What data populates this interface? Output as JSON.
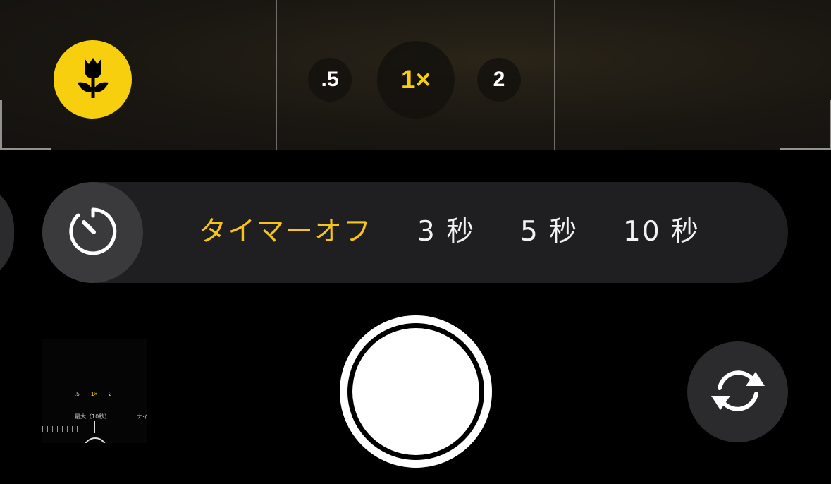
{
  "viewfinder": {
    "zoom_levels": [
      {
        "label": ".5",
        "active": false
      },
      {
        "label": "1×",
        "active": true
      },
      {
        "label": "2",
        "active": false
      }
    ],
    "macro_icon": "tulip-icon",
    "macro_color": "#f7cf0e"
  },
  "timer": {
    "icon": "timer-icon",
    "options": [
      {
        "label": "タイマーオフ",
        "selected": true
      },
      {
        "label": "3 秒",
        "selected": false
      },
      {
        "label": "5 秒",
        "selected": false
      },
      {
        "label": "10 秒",
        "selected": false
      }
    ],
    "selected_color": "#f7c51a"
  },
  "thumbnail": {
    "zoom_labels": [
      ".5",
      "1×",
      "2"
    ],
    "caption": "最大（10秒）",
    "caption_right": "ナイ"
  },
  "controls": {
    "shutter_icon": "shutter-button",
    "flip_icon": "camera-flip-icon"
  }
}
